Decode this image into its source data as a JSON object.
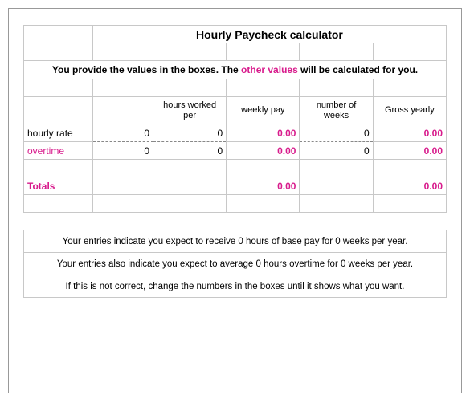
{
  "title": "Hourly Paycheck calculator",
  "instruction_pre": "You provide the values in the boxes.  The ",
  "instruction_mid": "other values",
  "instruction_post": " will be calculated for you.",
  "headers": {
    "hours_worked": "hours worked per",
    "weekly_pay": "weekly pay",
    "num_weeks": "number of weeks",
    "gross_yearly": "Gross yearly"
  },
  "rows": {
    "hourly": {
      "label": "hourly rate",
      "rate": "0",
      "hours": "0",
      "weekly": "0.00",
      "weeks": "0",
      "gross": "0.00"
    },
    "overtime": {
      "label": "overtime",
      "rate": "0",
      "hours": "0",
      "weekly": "0.00",
      "weeks": "0",
      "gross": "0.00"
    }
  },
  "totals": {
    "label": "Totals",
    "weekly": "0.00",
    "gross": "0.00"
  },
  "summary": {
    "line1": "Your entries indicate you expect to receive 0 hours of base pay for 0 weeks per year.",
    "line2": "Your entries also indicate you expect to average 0 hours overtime for 0 weeks per year.",
    "line3": "If this is not correct, change the numbers in the boxes until it shows what you want."
  }
}
